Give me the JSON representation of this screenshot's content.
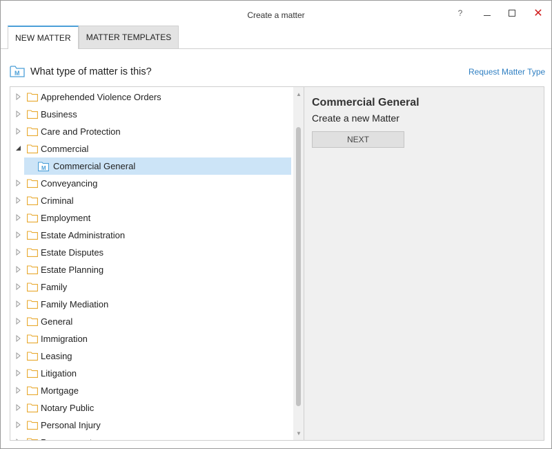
{
  "window": {
    "title": "Create a matter",
    "help_label": "?",
    "close_label": "✕"
  },
  "tabs": [
    {
      "label": "NEW MATTER",
      "active": true
    },
    {
      "label": "MATTER TEMPLATES",
      "active": false
    }
  ],
  "header": {
    "question": "What type of matter is this?",
    "request_link": "Request Matter Type"
  },
  "tree": {
    "items": [
      {
        "label": "Apprehended Violence Orders",
        "expanded": false
      },
      {
        "label": "Business",
        "expanded": false
      },
      {
        "label": "Care and Protection",
        "expanded": false
      },
      {
        "label": "Commercial",
        "expanded": true
      },
      {
        "label": "Commercial General",
        "child": true,
        "selected": true
      },
      {
        "label": "Conveyancing",
        "expanded": false
      },
      {
        "label": "Criminal",
        "expanded": false
      },
      {
        "label": "Employment",
        "expanded": false
      },
      {
        "label": "Estate Administration",
        "expanded": false
      },
      {
        "label": "Estate Disputes",
        "expanded": false
      },
      {
        "label": "Estate Planning",
        "expanded": false
      },
      {
        "label": "Family",
        "expanded": false
      },
      {
        "label": "Family Mediation",
        "expanded": false
      },
      {
        "label": "General",
        "expanded": false
      },
      {
        "label": "Immigration",
        "expanded": false
      },
      {
        "label": "Leasing",
        "expanded": false
      },
      {
        "label": "Litigation",
        "expanded": false
      },
      {
        "label": "Mortgage",
        "expanded": false
      },
      {
        "label": "Notary Public",
        "expanded": false
      },
      {
        "label": "Personal Injury",
        "expanded": false
      },
      {
        "label": "Procurement",
        "expanded": false
      }
    ]
  },
  "detail": {
    "title": "Commercial General",
    "subtitle": "Create a new Matter",
    "next_label": "NEXT"
  },
  "colors": {
    "accent": "#4a9fd8",
    "link": "#2f7fc2",
    "selection": "#cce4f7",
    "folder": "#e8a92f",
    "close": "#d01c1c"
  }
}
